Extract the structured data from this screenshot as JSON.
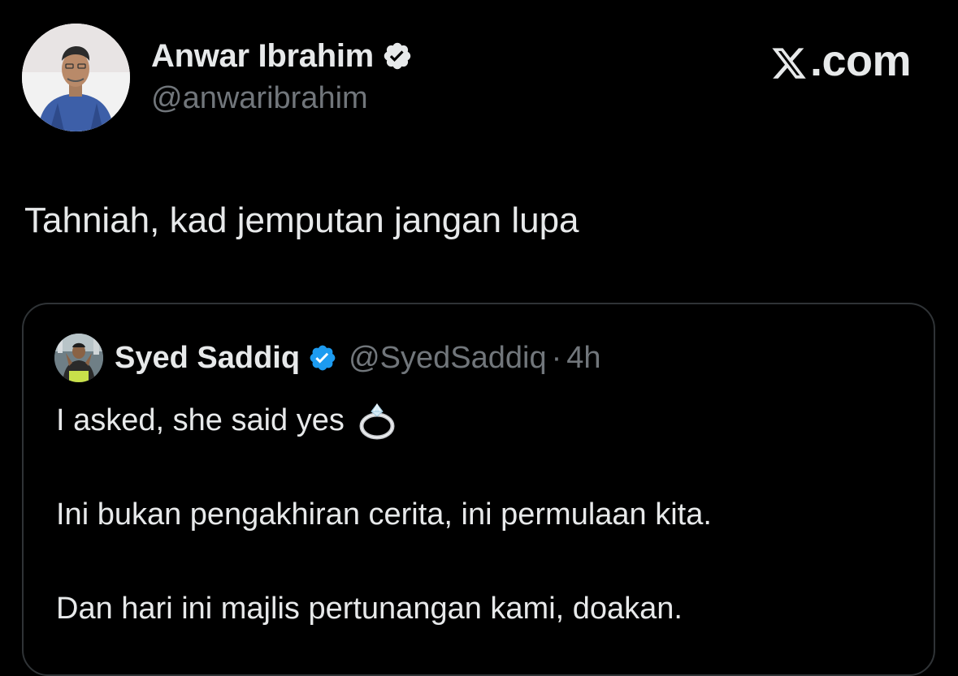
{
  "author": {
    "name": "Anwar Ibrahim",
    "handle": "@anwaribrahim",
    "verified": true,
    "avatar": "avatar-photo"
  },
  "brand": {
    "icon": "x-logo-icon",
    "suffix": ".com"
  },
  "tweet": {
    "text": "Tahniah, kad jemputan jangan lupa"
  },
  "quoted_tweet": {
    "name": "Syed Saddiq",
    "handle": "@SyedSaddiq",
    "separator": "·",
    "time": "4h",
    "verified": true,
    "lines": [
      "I asked, she said yes",
      "Ini bukan pengakhiran cerita, ini permulaan kita.",
      "Dan hari ini majlis pertunangan kami, doakan."
    ],
    "emoji": "ring-icon"
  },
  "colors": {
    "background": "#000000",
    "text": "#e7e9ea",
    "muted": "#71767b",
    "verified": "#1d9bf0",
    "border": "#2f3336"
  }
}
